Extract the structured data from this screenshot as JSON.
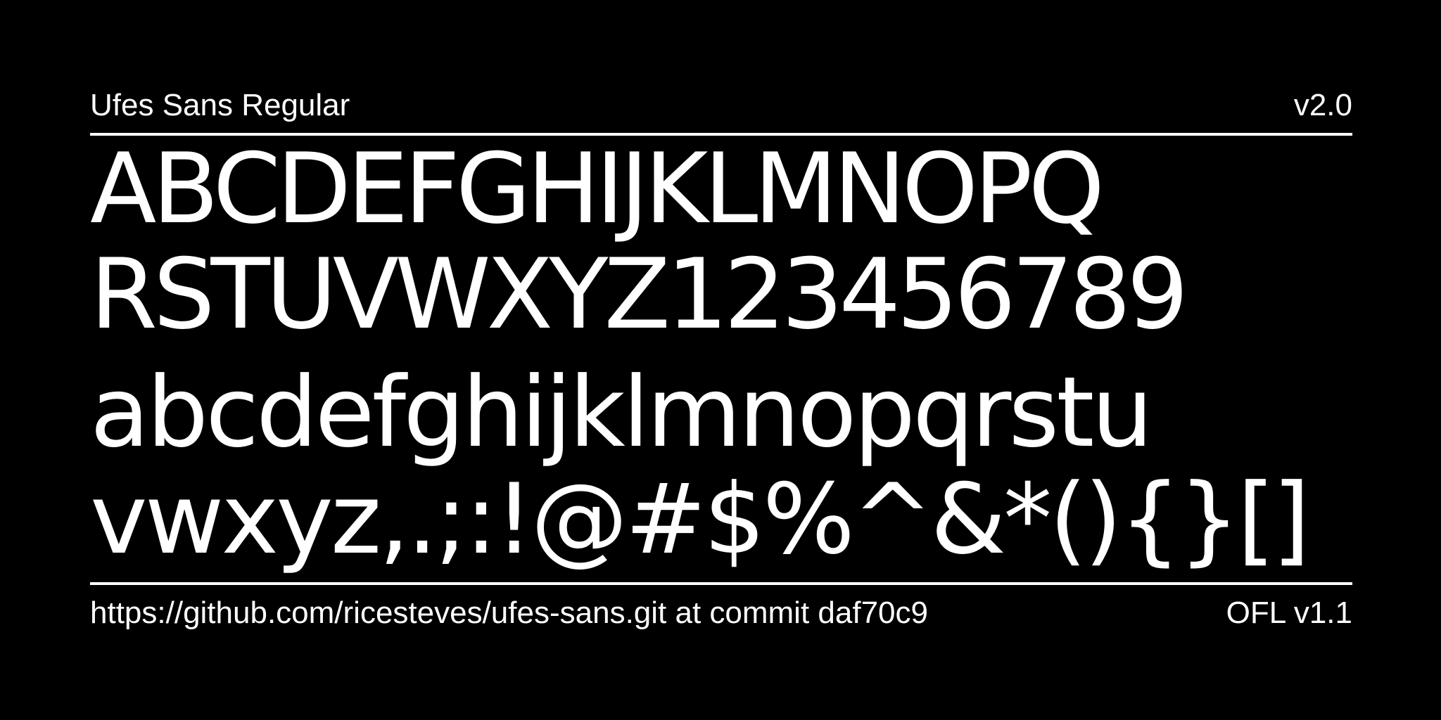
{
  "header": {
    "font_name": "Ufes Sans Regular",
    "version": "v2.0"
  },
  "specimen": {
    "lines": [
      "ABCDEFGHIJKLMNOPQ",
      "RSTUVWXYZ123456789",
      "abcdefghijklmnopqrstu",
      "vwxyz,.;:!@#$%^&*(){}[]"
    ]
  },
  "footer": {
    "source": "https://github.com/ricesteves/ufes-sans.git at commit daf70c9",
    "license": "OFL v1.1"
  },
  "colors": {
    "background": "#000000",
    "foreground": "#ffffff"
  }
}
